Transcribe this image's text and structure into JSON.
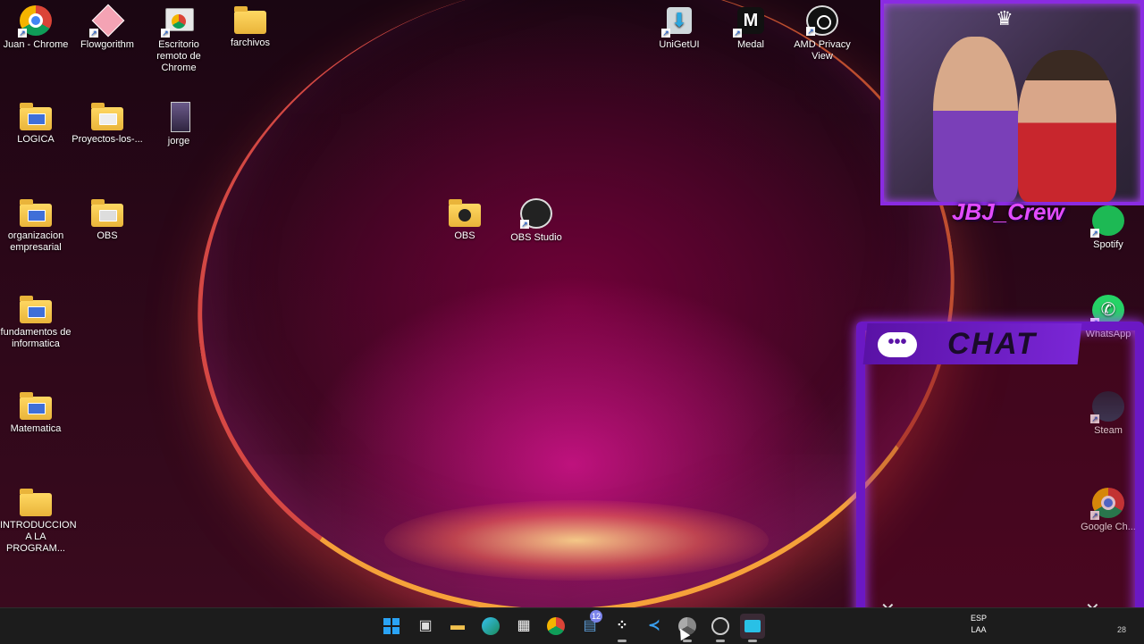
{
  "desktop_icons_left": [
    {
      "label": "Juan - Chrome",
      "icon": "chrome-profile-icon"
    },
    {
      "label": "Flowgorithm",
      "icon": "flowgorithm-icon"
    },
    {
      "label": "Escritorio remoto de Chrome",
      "icon": "chrome-remote-desktop-icon"
    },
    {
      "label": "farchivos",
      "icon": "folder-icon"
    },
    {
      "label": "LOGICA",
      "icon": "folder-icon"
    },
    {
      "label": "Proyectos-los-...",
      "icon": "folder-icon"
    },
    {
      "label": "jorge",
      "icon": "image-file-icon"
    },
    {
      "label": "organizacion empresarial",
      "icon": "folder-icon"
    },
    {
      "label": "OBS",
      "icon": "folder-icon"
    },
    {
      "label": "fundamentos de informatica",
      "icon": "folder-icon"
    },
    {
      "label": "Matematica",
      "icon": "folder-icon"
    },
    {
      "label": "INTRODUCCION A LA PROGRAM...",
      "icon": "folder-icon"
    }
  ],
  "desktop_icons_center": [
    {
      "label": "OBS",
      "icon": "folder-icon"
    },
    {
      "label": "OBS Studio",
      "icon": "obs-studio-icon"
    }
  ],
  "desktop_icons_right": [
    {
      "label": "UniGetUI",
      "icon": "unigetui-icon"
    },
    {
      "label": "Medal",
      "icon": "medal-icon"
    },
    {
      "label": "AMD Privacy View",
      "icon": "amd-privacy-view-icon"
    },
    {
      "label": "Spotify",
      "icon": "spotify-icon"
    },
    {
      "label": "WhatsApp",
      "icon": "whatsapp-icon"
    },
    {
      "label": "Steam",
      "icon": "steam-icon"
    },
    {
      "label": "Google Ch...",
      "icon": "google-chrome-icon"
    }
  ],
  "overlay": {
    "crew_label": "JBJ_Crew",
    "chat_title": "CHAT",
    "chat_bubble": "•••"
  },
  "taskbar": {
    "icons": [
      "windows-start-icon",
      "task-view-icon",
      "file-explorer-icon",
      "edge-icon",
      "store-icon",
      "chrome-icon",
      "teams-icon",
      "tidal-icon",
      "vscode-icon",
      "chrome-alt-icon",
      "obs-icon",
      "app-icon"
    ],
    "badge": "12",
    "language": "ESP",
    "layout": "LAA",
    "tray_time_fragment": "28"
  }
}
